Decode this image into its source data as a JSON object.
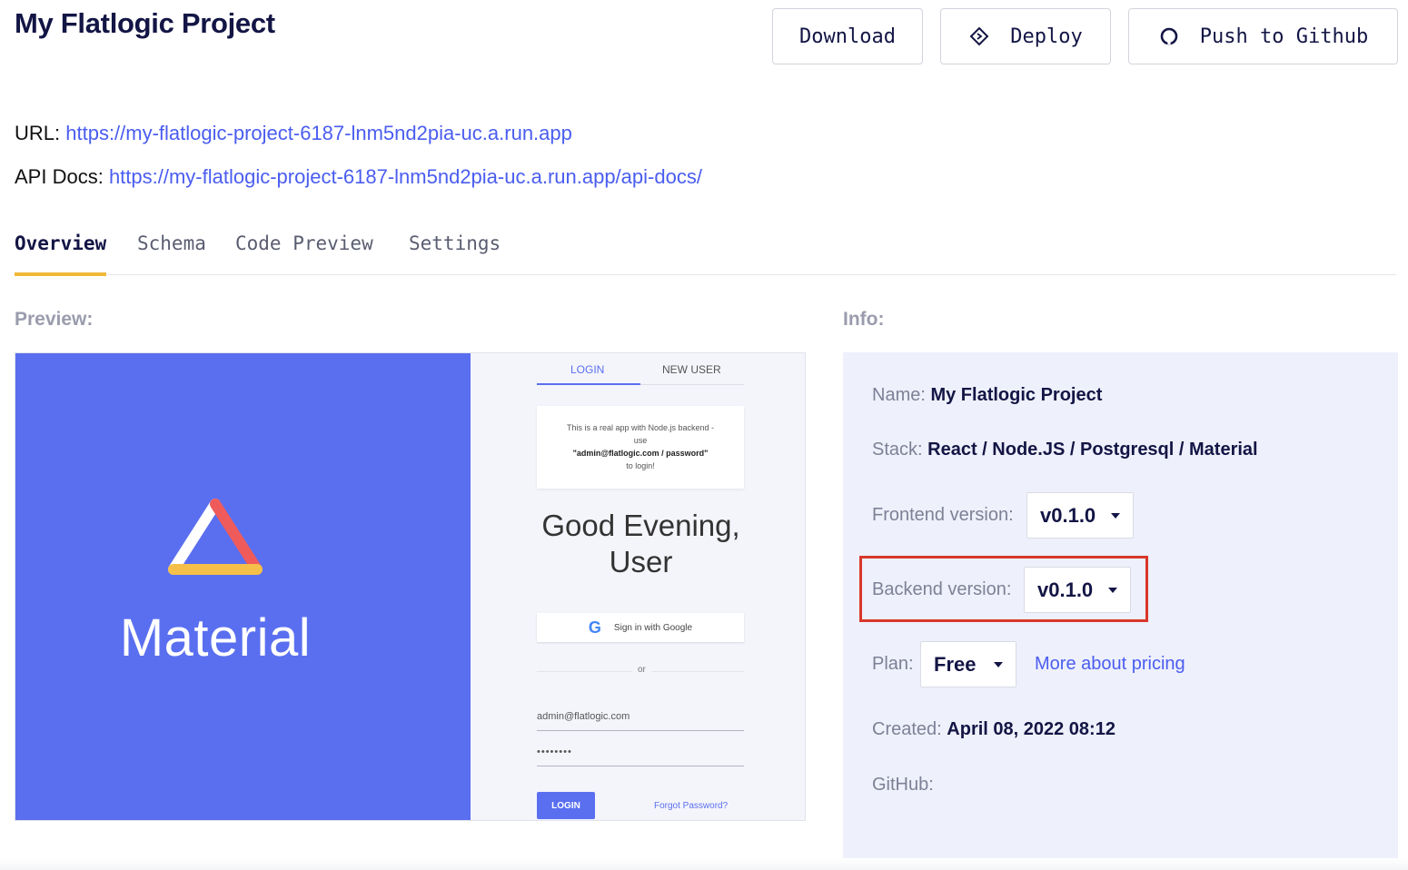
{
  "header": {
    "title": "My Flatlogic Project",
    "download_label": "Download",
    "deploy_label": "Deploy",
    "github_label": "Push to Github"
  },
  "links": {
    "url_label": "URL:",
    "url": "https://my-flatlogic-project-6187-lnm5nd2pia-uc.a.run.app",
    "api_label": "API Docs:",
    "api_url": "https://my-flatlogic-project-6187-lnm5nd2pia-uc.a.run.app/api-docs/"
  },
  "tabs": [
    {
      "label": "Overview",
      "active": true
    },
    {
      "label": "Schema"
    },
    {
      "label": "Code Preview"
    },
    {
      "label": "Settings"
    }
  ],
  "preview": {
    "label": "Preview:",
    "brand": "Material",
    "login_tab": "LOGIN",
    "new_user_tab": "NEW USER",
    "notice_line1": "This is a real app with Node.js backend -",
    "notice_line2": "use",
    "notice_line3": "\"admin@flatlogic.com / password\"",
    "notice_line4": "to login!",
    "greeting_line1": "Good Evening,",
    "greeting_line2": "User",
    "google_label": "Sign in with Google",
    "or_text": "or",
    "email": "admin@flatlogic.com",
    "password_mask": "••••••••",
    "login_button": "LOGIN",
    "forgot": "Forgot Password?"
  },
  "info": {
    "label": "Info:",
    "name_label": "Name:",
    "name": "My Flatlogic Project",
    "stack_label": "Stack:",
    "stack": "React / Node.JS / Postgresql / Material",
    "frontend_label": "Frontend version:",
    "frontend_version": "v0.1.0",
    "backend_label": "Backend version:",
    "backend_version": "v0.1.0",
    "plan_label": "Plan:",
    "plan": "Free",
    "pricing_link": "More about pricing",
    "created_label": "Created:",
    "created": "April 08, 2022 08:12",
    "github_label": "GitHub:"
  },
  "colors": {
    "accent": "#4a5df0",
    "tab_indicator": "#f0b93a",
    "preview_bg": "#5a6ff0",
    "highlight": "#d9372c"
  },
  "icons": {
    "deploy": "deploy-diamond-icon",
    "github": "github-icon",
    "caret": "chevron-down-icon"
  }
}
